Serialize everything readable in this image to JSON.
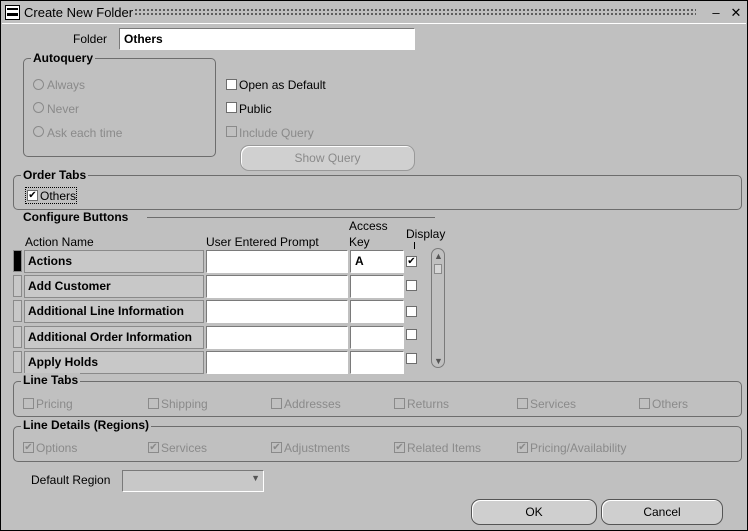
{
  "window": {
    "title": "Create New Folder",
    "minimize": "–",
    "close": "✕"
  },
  "folder": {
    "label": "Folder",
    "value": "Others"
  },
  "autoquery": {
    "title": "Autoquery",
    "options": [
      "Always",
      "Never",
      "Ask each time"
    ]
  },
  "settings": {
    "open_as_default": "Open as Default",
    "public": "Public",
    "include_query": "Include Query",
    "show_query": "Show Query"
  },
  "order_tabs": {
    "title": "Order Tabs",
    "item": "Others",
    "checked": true
  },
  "configure_buttons": {
    "title": "Configure Buttons",
    "headers": {
      "action_name": "Action Name",
      "user_prompt": "User Entered Prompt",
      "access_key_1": "Access",
      "access_key_2": "Key",
      "display": "Display"
    },
    "rows": [
      {
        "action": "Actions",
        "prompt": "",
        "key": "A",
        "display": true
      },
      {
        "action": "Add Customer",
        "prompt": "",
        "key": "",
        "display": false
      },
      {
        "action": "Additional Line Information",
        "prompt": "",
        "key": "",
        "display": false
      },
      {
        "action": "Additional Order Information",
        "prompt": "",
        "key": "",
        "display": false
      },
      {
        "action": "Apply Holds",
        "prompt": "",
        "key": "",
        "display": false
      }
    ]
  },
  "line_tabs": {
    "title": "Line Tabs",
    "items": [
      "Pricing",
      "Shipping",
      "Addresses",
      "Returns",
      "Services",
      "Others"
    ]
  },
  "line_details": {
    "title": "Line Details (Regions)",
    "items": [
      "Options",
      "Services",
      "Adjustments",
      "Related Items",
      "Pricing/Availability"
    ]
  },
  "default_region": {
    "label": "Default Region",
    "value": ""
  },
  "buttons": {
    "ok": "OK",
    "cancel": "Cancel"
  }
}
